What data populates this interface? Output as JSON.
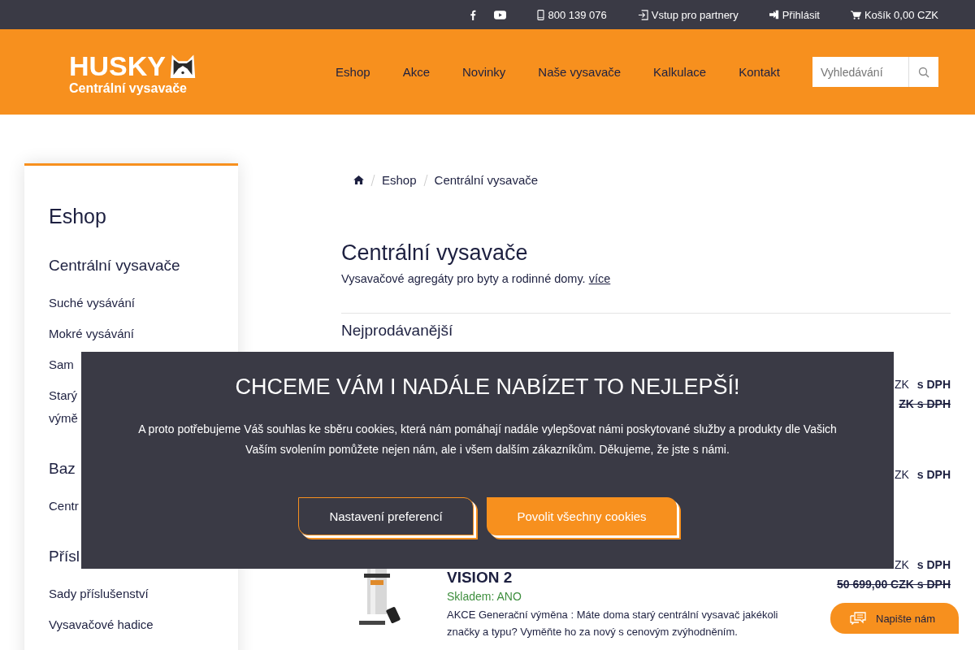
{
  "top_bar": {
    "phone": "800 139 076",
    "partners": "Vstup pro partnery",
    "login": "Přihlásit",
    "cart": "Košík 0,00 CZK"
  },
  "header": {
    "logo_title": "HUSKY",
    "logo_subtitle": "Centrální vysavače",
    "nav": [
      {
        "label": "Eshop"
      },
      {
        "label": "Akce"
      },
      {
        "label": "Novinky"
      },
      {
        "label": "Naše vysavače"
      },
      {
        "label": "Kalkulace"
      },
      {
        "label": "Kontakt"
      }
    ],
    "search": {
      "placeholder": "Vyhledávání"
    }
  },
  "sidebar": {
    "title": "Eshop",
    "sections": [
      {
        "heading": "Centrální vysavače",
        "items": [
          [
            "Suché vysávání"
          ],
          [
            "Mokré vysávání"
          ],
          [
            "Sam"
          ],
          [
            "Starý",
            "výmě"
          ]
        ]
      },
      {
        "heading": "Baz",
        "items": [
          [
            "Centr"
          ]
        ]
      },
      {
        "heading": "Přísl",
        "items": [
          [
            "Sady příslušenství"
          ],
          [
            "Vysavačové hadice"
          ]
        ]
      }
    ]
  },
  "breadcrumb": [
    "Eshop",
    "Centrální vysavače"
  ],
  "page": {
    "title": "Centrální vysavače",
    "description": "Vysavačové agregáty pro byty a rodinné domy.",
    "more_link": "více",
    "section": "Nejprodávanější"
  },
  "products": [
    {
      "kind": "hidden",
      "price": "ZK",
      "tax": "s DPH",
      "old_price": "ZK s DPH"
    },
    {
      "kind": "hidden",
      "price": "ZK",
      "tax": "s DPH"
    },
    {
      "kind": "full",
      "name": "VISION 2",
      "stock": "Skladem: ANO",
      "description": "AKCE Generační výměna : Máte doma starý centrální vysavač jakékoli značky a typu? Vyměňte ho za nový s cenovým zvýhodněním.",
      "price": "ZK",
      "tax": "s DPH",
      "old_price": "50 699,00 CZK s DPH"
    }
  ],
  "cookie_dialog": {
    "title": "CHCEME VÁM I NADÁLE NABÍZET TO NEJLEPŠÍ!",
    "lines": [
      "A proto potřebujeme Váš souhlas ke sběru cookies, která nám pomáhají nadále vylepšovat námi poskytované služby a produkty dle Vašich",
      "Vaším svolením pomůžete nejen nám, ale i všem dalším zákazníkům. Děkujeme, že jste s námi."
    ],
    "buttons": [
      {
        "label": "Nastavení preferencí",
        "kind": "secondary"
      },
      {
        "label": "Povolit všechny cookies",
        "kind": "primary"
      }
    ]
  },
  "chat_button": {
    "label": "Napište nám"
  }
}
